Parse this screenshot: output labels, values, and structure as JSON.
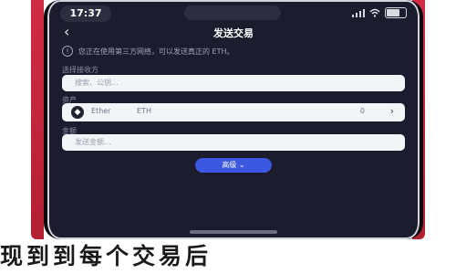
{
  "status_bar": {
    "time": "17:37"
  },
  "nav": {
    "title": "发送交易",
    "back_icon": "chevron-left-icon"
  },
  "notice": {
    "icon": "info-icon",
    "text": "您正在使用第三方网络，可以发送真正的 ETH。"
  },
  "form": {
    "recipient": {
      "label": "选择接收方",
      "placeholder": "搜索、公钥..."
    },
    "asset": {
      "label": "资产",
      "name": "Ether",
      "symbol": "ETH",
      "balance": "0"
    },
    "amount": {
      "label": "金额",
      "placeholder": "发送金额..."
    },
    "advanced_label": "高级"
  },
  "caption": {
    "text": "现到到每个交易后"
  },
  "colors": {
    "screen_bg": "#1b1d2e",
    "rail": "#c92640",
    "accent": "#3c57e0",
    "field_bg": "#f3f4f8"
  }
}
